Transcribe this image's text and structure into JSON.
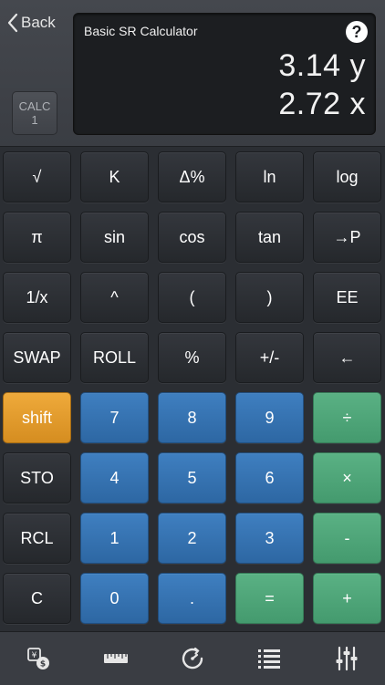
{
  "header": {
    "back_label": "Back",
    "calc_label_top": "CALC",
    "calc_label_num": "1"
  },
  "display": {
    "title": "Basic SR Calculator",
    "help": "?",
    "y_value": "3.14 y",
    "x_value": "2.72 x"
  },
  "keys": [
    {
      "label": "√",
      "name": "sqrt-key",
      "kind": "fn"
    },
    {
      "label": "K",
      "name": "k-key",
      "kind": "fn"
    },
    {
      "label": "Δ%",
      "name": "delta-percent-key",
      "kind": "fn"
    },
    {
      "label": "ln",
      "name": "ln-key",
      "kind": "fn"
    },
    {
      "label": "log",
      "name": "log-key",
      "kind": "fn"
    },
    {
      "label": "π",
      "name": "pi-key",
      "kind": "fn"
    },
    {
      "label": "sin",
      "name": "sin-key",
      "kind": "fn"
    },
    {
      "label": "cos",
      "name": "cos-key",
      "kind": "fn"
    },
    {
      "label": "tan",
      "name": "tan-key",
      "kind": "fn"
    },
    {
      "label": "→P",
      "name": "to-polar-key",
      "kind": "fn"
    },
    {
      "label": "1/x",
      "name": "reciprocal-key",
      "kind": "fn"
    },
    {
      "label": "^",
      "name": "power-key",
      "kind": "fn"
    },
    {
      "label": "(",
      "name": "open-paren-key",
      "kind": "fn"
    },
    {
      "label": ")",
      "name": "close-paren-key",
      "kind": "fn"
    },
    {
      "label": "EE",
      "name": "ee-key",
      "kind": "fn"
    },
    {
      "label": "SWAP",
      "name": "swap-key",
      "kind": "fn"
    },
    {
      "label": "ROLL",
      "name": "roll-key",
      "kind": "fn"
    },
    {
      "label": "%",
      "name": "percent-key",
      "kind": "fn"
    },
    {
      "label": "+/-",
      "name": "sign-key",
      "kind": "fn"
    },
    {
      "label": "←",
      "name": "backspace-key",
      "kind": "fn"
    },
    {
      "label": "shift",
      "name": "shift-key",
      "kind": "shift"
    },
    {
      "label": "7",
      "name": "digit-7-key",
      "kind": "num"
    },
    {
      "label": "8",
      "name": "digit-8-key",
      "kind": "num"
    },
    {
      "label": "9",
      "name": "digit-9-key",
      "kind": "num"
    },
    {
      "label": "÷",
      "name": "divide-key",
      "kind": "op"
    },
    {
      "label": "STO",
      "name": "sto-key",
      "kind": "fn"
    },
    {
      "label": "4",
      "name": "digit-4-key",
      "kind": "num"
    },
    {
      "label": "5",
      "name": "digit-5-key",
      "kind": "num"
    },
    {
      "label": "6",
      "name": "digit-6-key",
      "kind": "num"
    },
    {
      "label": "×",
      "name": "multiply-key",
      "kind": "op"
    },
    {
      "label": "RCL",
      "name": "rcl-key",
      "kind": "fn"
    },
    {
      "label": "1",
      "name": "digit-1-key",
      "kind": "num"
    },
    {
      "label": "2",
      "name": "digit-2-key",
      "kind": "num"
    },
    {
      "label": "3",
      "name": "digit-3-key",
      "kind": "num"
    },
    {
      "label": "-",
      "name": "subtract-key",
      "kind": "op"
    },
    {
      "label": "C",
      "name": "clear-key",
      "kind": "fn"
    },
    {
      "label": "0",
      "name": "digit-0-key",
      "kind": "num"
    },
    {
      "label": ".",
      "name": "decimal-key",
      "kind": "num"
    },
    {
      "label": "=",
      "name": "equals-key",
      "kind": "op"
    },
    {
      "label": "+",
      "name": "add-key",
      "kind": "op"
    }
  ],
  "tabs": [
    {
      "name": "currency-convert-icon"
    },
    {
      "name": "ruler-icon"
    },
    {
      "name": "history-clock-icon"
    },
    {
      "name": "list-icon"
    },
    {
      "name": "settings-sliders-icon"
    }
  ],
  "colors": {
    "num_key": "#3a78b8",
    "op_key": "#52a87b",
    "shift_key": "#e29a2c",
    "fn_key": "#2d3035"
  }
}
